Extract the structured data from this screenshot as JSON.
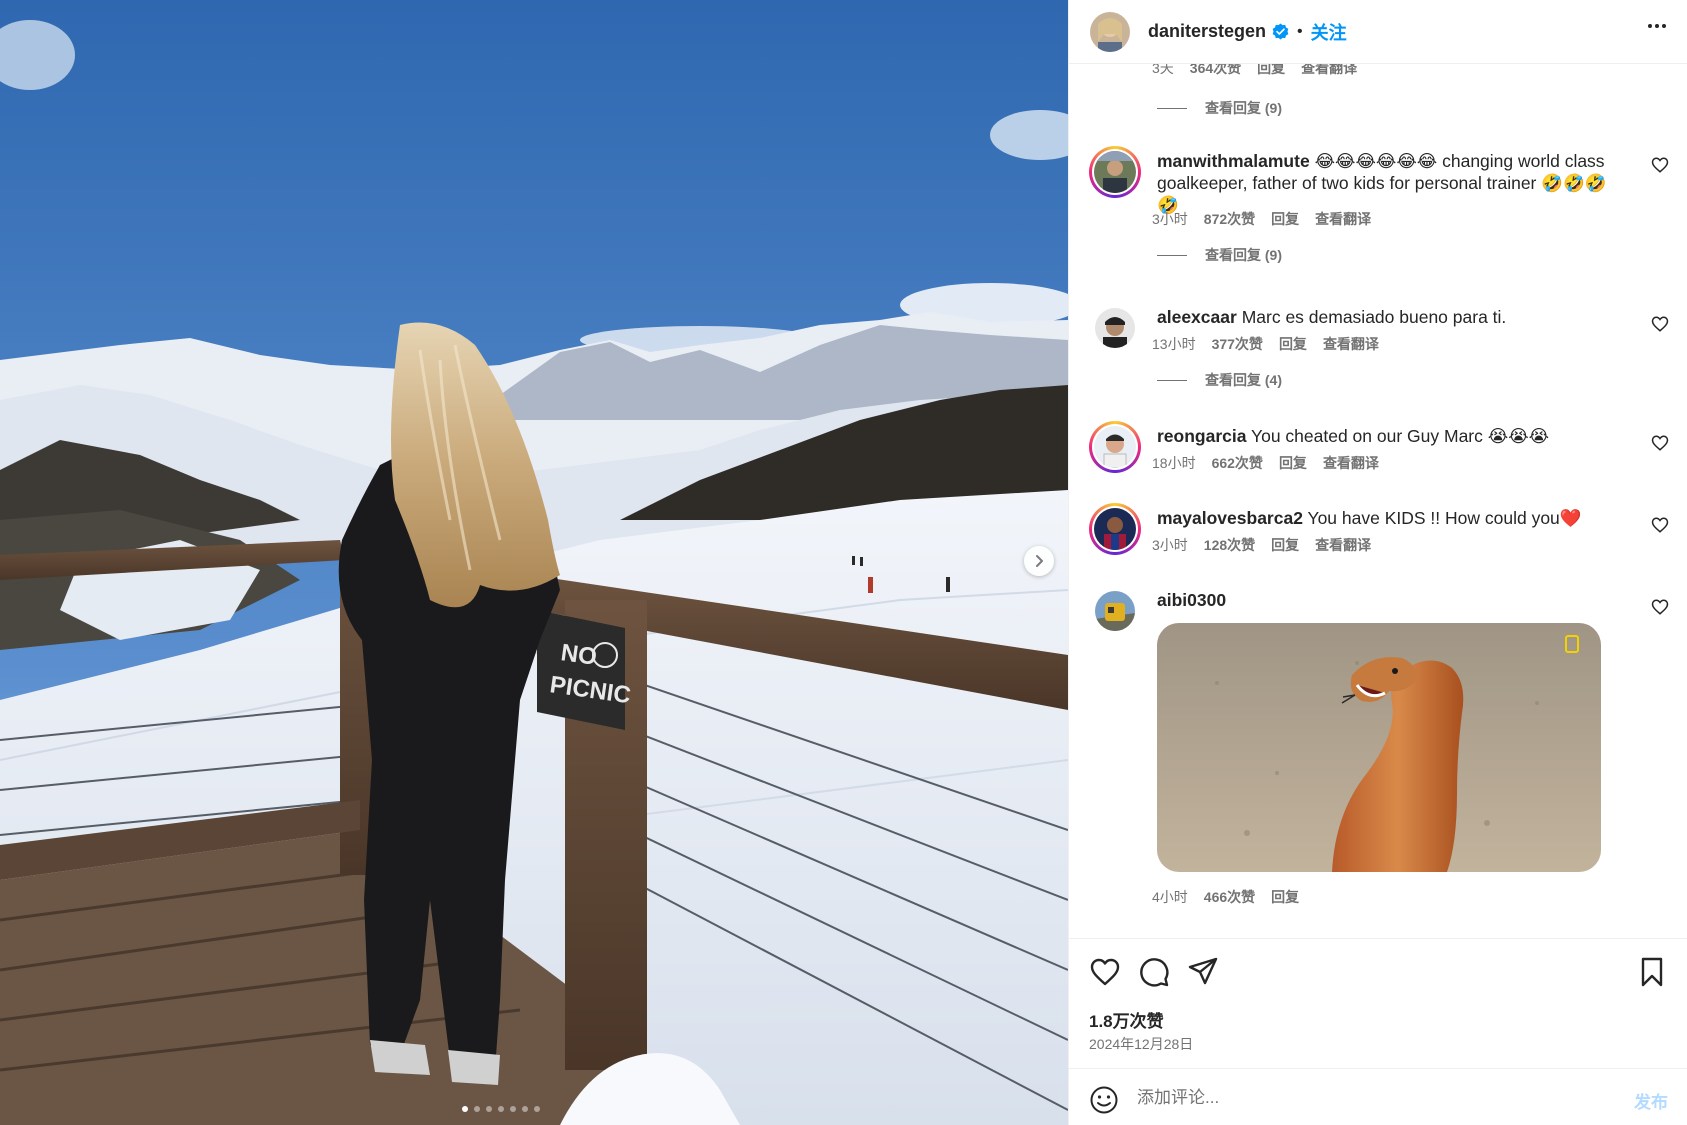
{
  "post": {
    "username": "daniterstegen",
    "separator": "•",
    "follow_label": "关注",
    "verified_icon": "verified-badge-icon",
    "more_icon": "more-horizontal-icon"
  },
  "media": {
    "sign_text_line1": "NO",
    "sign_text_line2": "PICNIC",
    "carousel_dots": 7,
    "active_dot": 1,
    "next_icon": "chevron-right-icon"
  },
  "comments": {
    "top_partial": {
      "time": "3天",
      "likes": "364次赞",
      "reply": "回复",
      "translate": "查看翻译"
    },
    "top_view_replies": "查看回复 (9)",
    "items": [
      {
        "username": "manwithmalamute",
        "text": "😂😂😂😂😂😂 changing world class goalkeeper, father of two kids for personal trainer 🤣🤣🤣🤣",
        "time": "3小时",
        "likes": "872次赞",
        "reply": "回复",
        "translate": "查看翻译",
        "view_replies": "查看回复 (9)"
      },
      {
        "username": "aleexcaar",
        "text": "Marc es demasiado bueno para ti.",
        "time": "13小时",
        "likes": "377次赞",
        "reply": "回复",
        "translate": "查看翻译",
        "view_replies": "查看回复 (4)"
      },
      {
        "username": "reongarcia",
        "text": "You cheated on our Guy Marc 😭😭😭",
        "time": "18小时",
        "likes": "662次赞",
        "reply": "回复",
        "translate": "查看翻译"
      },
      {
        "username": "mayalovesbarca2",
        "text": "You have KIDS !! How could you❤️",
        "time": "3小时",
        "likes": "128次赞",
        "reply": "回复",
        "translate": "查看翻译"
      },
      {
        "username": "aibi0300",
        "text": "",
        "time": "4小时",
        "likes": "466次赞",
        "reply": "回复"
      }
    ]
  },
  "actions": {
    "like_icon": "heart-icon",
    "comment_icon": "comment-icon",
    "share_icon": "send-icon",
    "save_icon": "bookmark-icon",
    "likes_total": "1.8万次赞",
    "date": "2024年12月28日"
  },
  "composer": {
    "emoji_icon": "emoji-icon",
    "placeholder": "添加评论...",
    "post_label": "发布"
  },
  "colors": {
    "accent": "#0095f6",
    "text_primary": "#262626",
    "text_secondary": "#737373",
    "post_disabled": "#b3dbff"
  }
}
